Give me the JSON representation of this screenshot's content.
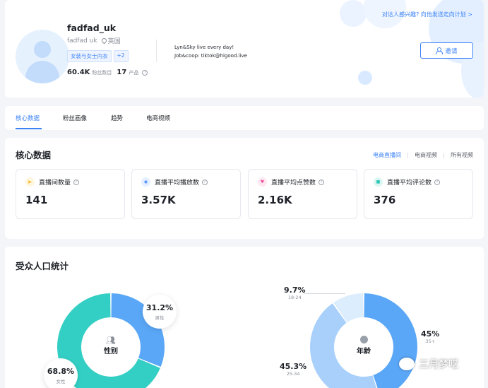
{
  "profile": {
    "name": "fadfad_uk",
    "handle": "fadfad uk",
    "country": "英国",
    "tags": [
      "女装与女士内衣",
      "+2"
    ],
    "followers_value": "60.4K",
    "followers_label": "粉丝数目",
    "products_value": "17",
    "products_label": "产品",
    "bio_line1": "Lyn&Sky live every day!",
    "bio_line2": "Job&coop: tiktok@higood.live",
    "promo_text": "对达人感兴趣? 向他发送走向计划 >",
    "invite_label": "邀请"
  },
  "tabs": [
    "核心数据",
    "粉丝画像",
    "趋势",
    "电商视频"
  ],
  "core": {
    "title": "核心数据",
    "subtabs": [
      "电商直播间",
      "电商视频",
      "所有视频"
    ],
    "metrics": [
      {
        "label": "直播间数量",
        "value": "141",
        "icon": "play-icon",
        "color": "#f5b82e",
        "bg": "#fff6de"
      },
      {
        "label": "直播平均播放数",
        "value": "3.57K",
        "icon": "eye-icon",
        "color": "#3b82f6",
        "bg": "#e4efff"
      },
      {
        "label": "直播平均点赞数",
        "value": "2.16K",
        "icon": "heart-icon",
        "color": "#ec4899",
        "bg": "#fde8f2"
      },
      {
        "label": "直播平均评论数",
        "value": "376",
        "icon": "comment-icon",
        "color": "#2ec4b6",
        "bg": "#dcf6f2"
      }
    ]
  },
  "audience": {
    "title": "受众人口统计",
    "gender_center": "性别",
    "age_center": "年龄"
  },
  "colors": {
    "accent": "#3b82f6",
    "male": "#5aa7f7",
    "female": "#34cfc4",
    "age_35": "#5aa7f7",
    "age_2534": "#a8d0fb",
    "age_1824": "#dcedfd"
  },
  "chart_data": [
    {
      "type": "pie",
      "title": "性别",
      "categories": [
        "男性",
        "女性"
      ],
      "values": [
        31.2,
        68.8
      ],
      "unit": "%"
    },
    {
      "type": "pie",
      "title": "年龄",
      "categories": [
        "35+",
        "25-34",
        "18-24"
      ],
      "values": [
        45,
        45.3,
        9.7
      ],
      "unit": "%"
    }
  ],
  "watermark": "三月梦呓"
}
